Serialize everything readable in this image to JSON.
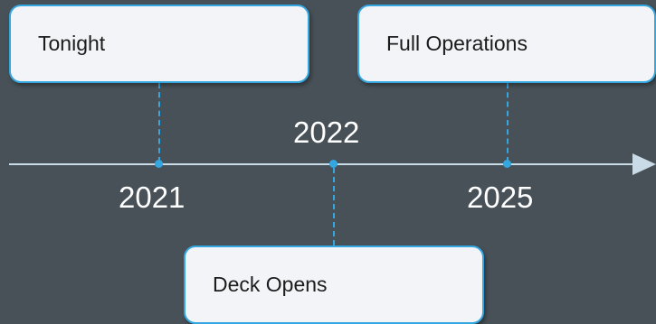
{
  "axis": {
    "color": "#c9dbe7"
  },
  "accent_color": "#34a6e0",
  "milestones": [
    {
      "year": "2021",
      "event": "Tonight"
    },
    {
      "year": "2022",
      "event": "Deck Opens"
    },
    {
      "year": "2025",
      "event": "Full Operations"
    }
  ]
}
